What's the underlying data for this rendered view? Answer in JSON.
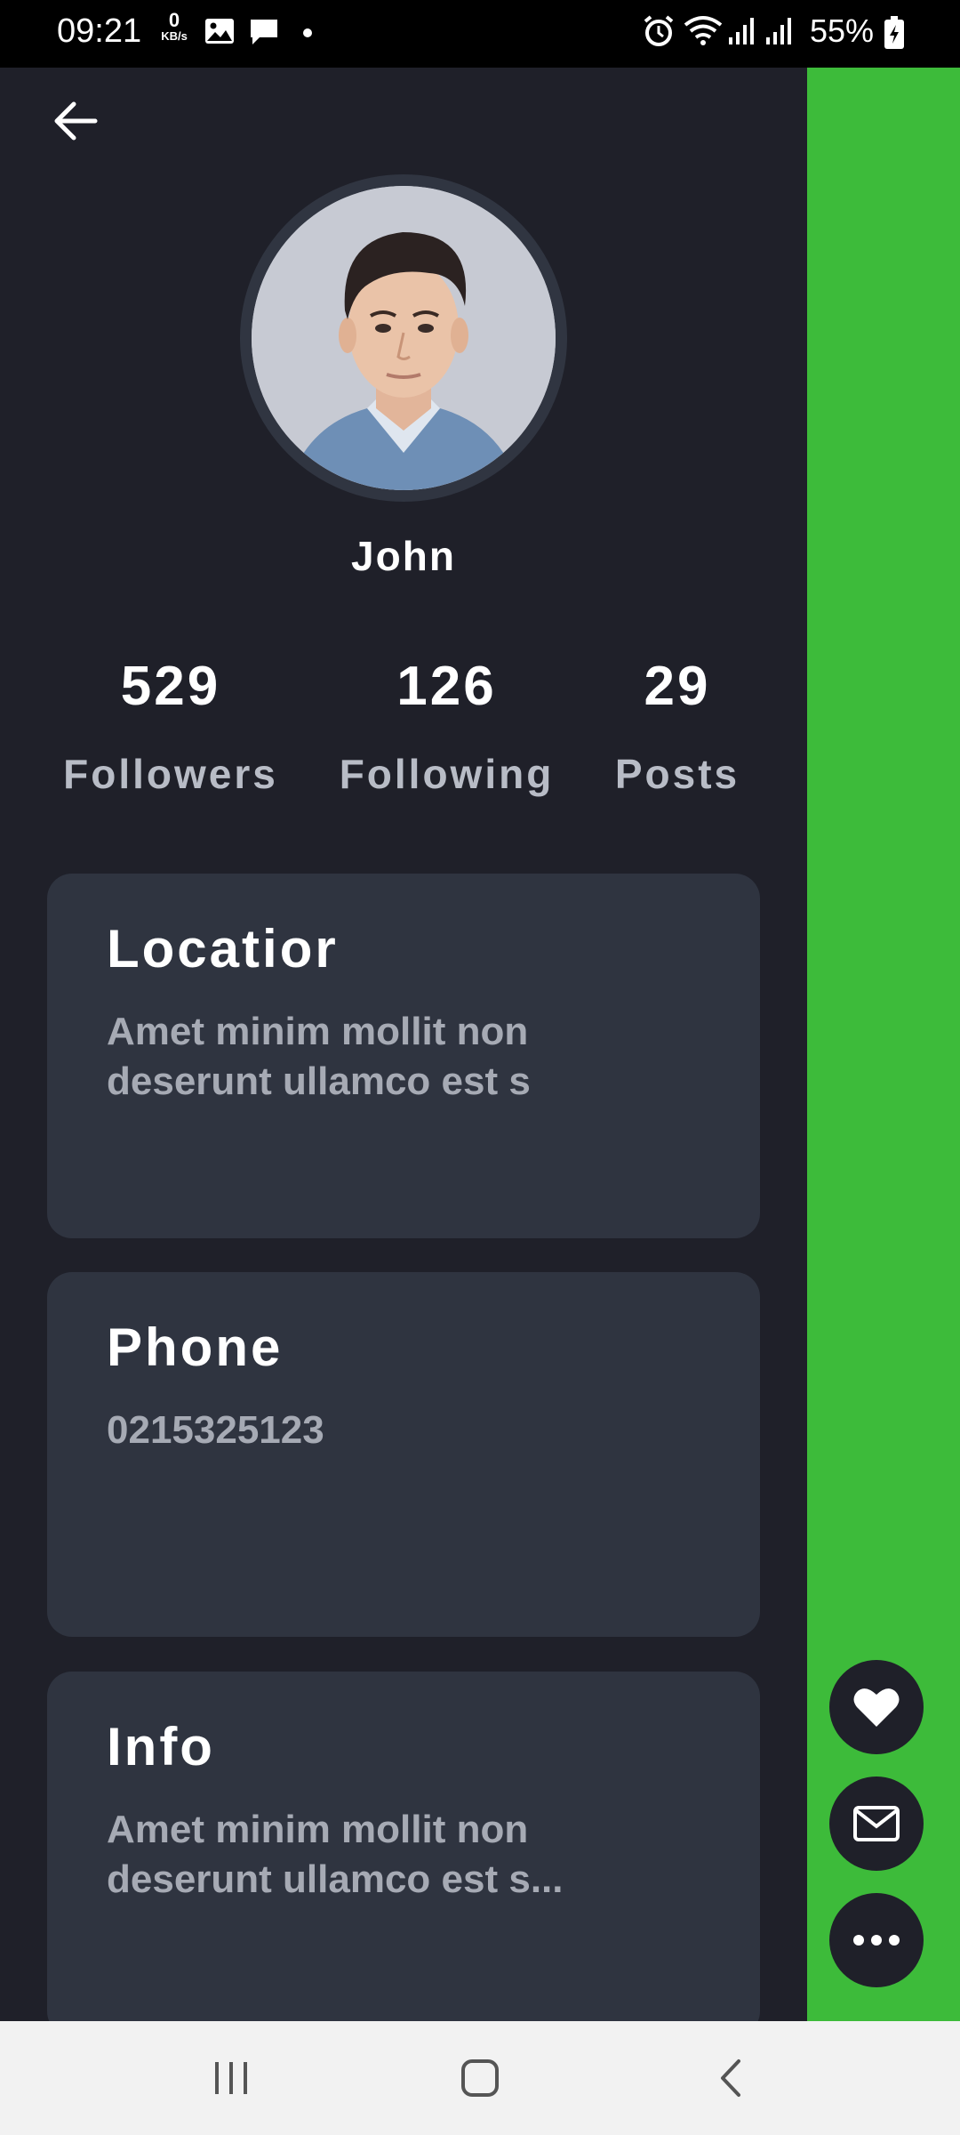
{
  "status_bar": {
    "time": "09:21",
    "net_speed_value": "0",
    "net_speed_unit": "KB/s",
    "battery": "55%",
    "icons": [
      "image-icon",
      "message-icon",
      "alarm-icon",
      "wifi-icon",
      "signal-icon",
      "signal-icon",
      "battery-charging-icon"
    ]
  },
  "profile": {
    "name": "John",
    "avatar": "profile-photo",
    "stats": [
      {
        "value": "529",
        "label": "Followers"
      },
      {
        "value": "126",
        "label": "Following"
      },
      {
        "value": "29",
        "label": "Posts"
      }
    ]
  },
  "cards": [
    {
      "title": "Locatior",
      "body": "Amet minim mollit non deserunt ullamco est s"
    },
    {
      "title": "Phone",
      "body": "0215325123"
    },
    {
      "title": "Info",
      "body": "Amet minim mollit non deserunt ullamco est s..."
    }
  ],
  "actions": {
    "icons": [
      "heart-icon",
      "mail-icon",
      "more-icon"
    ]
  },
  "colors": {
    "background": "#1f2029",
    "card": "#2f3440",
    "accent_green": "#3dbb3a",
    "text_primary": "#ffffff",
    "text_secondary": "#a6aab4"
  },
  "navigation": {
    "icons": [
      "recent-apps-icon",
      "home-icon",
      "back-icon"
    ]
  }
}
